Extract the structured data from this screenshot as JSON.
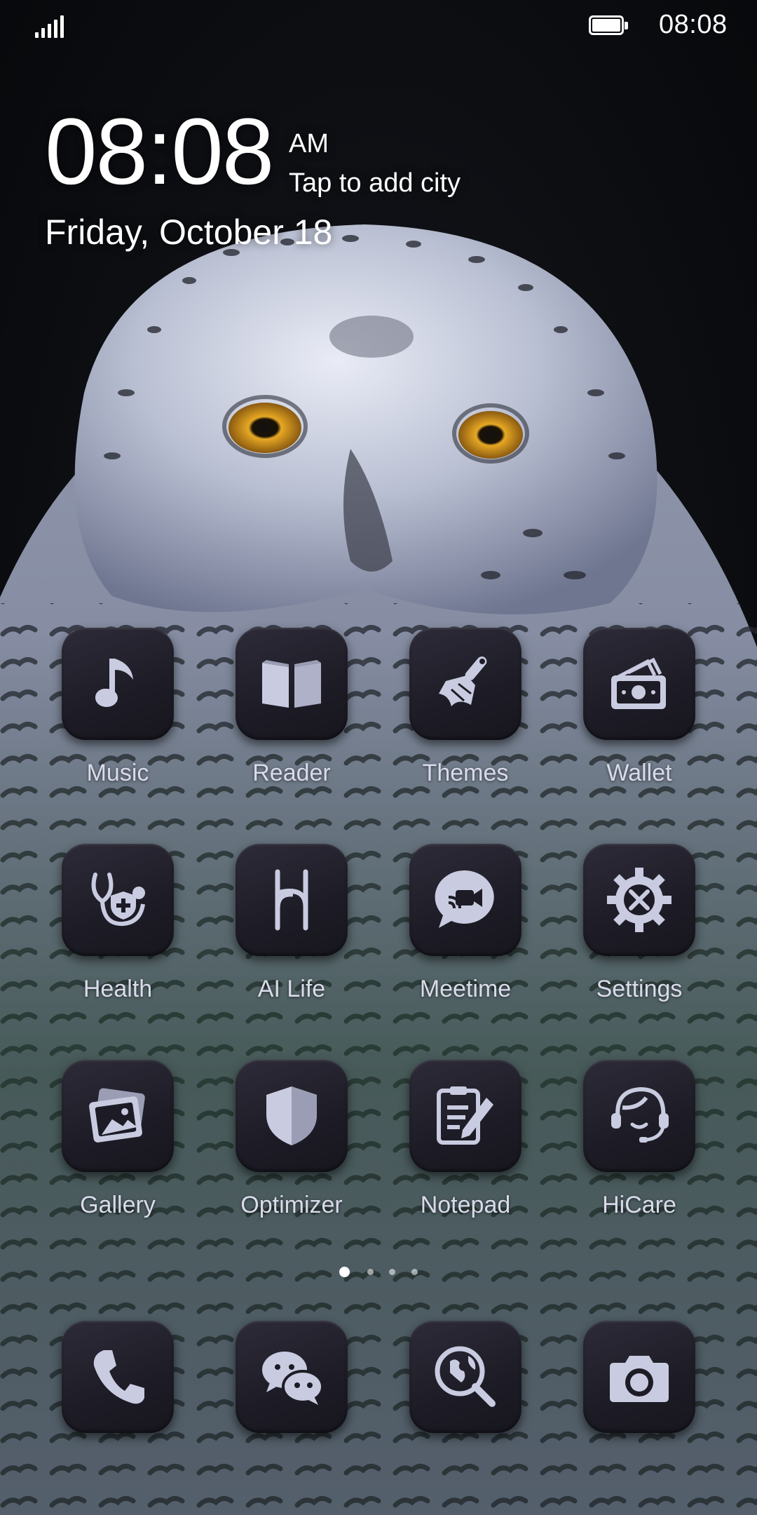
{
  "status_bar": {
    "time": "08:08",
    "battery_icon": "battery-full-icon",
    "signal_icon": "signal-bars-icon"
  },
  "clock_widget": {
    "time": "08:08",
    "ampm": "AM",
    "city_prompt": "Tap to add city",
    "date": "Friday, October 18"
  },
  "apps": [
    {
      "label": "Music",
      "icon": "music-note-icon"
    },
    {
      "label": "Reader",
      "icon": "open-book-icon"
    },
    {
      "label": "Themes",
      "icon": "paint-brush-icon"
    },
    {
      "label": "Wallet",
      "icon": "wallet-cash-icon"
    },
    {
      "label": "Health",
      "icon": "stethoscope-shield-icon"
    },
    {
      "label": "AI Life",
      "icon": "ai-life-icon"
    },
    {
      "label": "Meetime",
      "icon": "video-chat-bubble-icon"
    },
    {
      "label": "Settings",
      "icon": "gear-tools-icon"
    },
    {
      "label": "Gallery",
      "icon": "photo-stack-icon"
    },
    {
      "label": "Optimizer",
      "icon": "shield-icon"
    },
    {
      "label": "Notepad",
      "icon": "clipboard-pencil-icon"
    },
    {
      "label": "HiCare",
      "icon": "headset-agent-icon"
    }
  ],
  "page_indicator": {
    "total": 4,
    "active": 1
  },
  "dock": [
    {
      "icon": "phone-icon"
    },
    {
      "icon": "chat-bubbles-icon"
    },
    {
      "icon": "globe-search-icon"
    },
    {
      "icon": "camera-icon"
    }
  ],
  "colors": {
    "tile": "#1d1c26",
    "glyph": "#c9cbe0",
    "label": "#d9dbea"
  }
}
